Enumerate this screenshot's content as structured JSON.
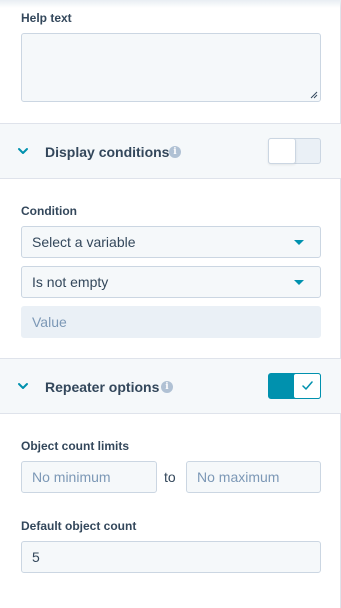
{
  "help_text": {
    "label": "Help text",
    "value": ""
  },
  "display_conditions": {
    "title": "Display conditions",
    "toggle_on": false,
    "condition_label": "Condition",
    "variable_select": "Select a variable",
    "operator_select": "Is not empty",
    "value_placeholder": "Value"
  },
  "repeater_options": {
    "title": "Repeater options",
    "toggle_on": true,
    "count_limits_label": "Object count limits",
    "min_placeholder": "No minimum",
    "to_text": "to",
    "max_placeholder": "No maximum",
    "default_count_label": "Default object count",
    "default_count_value": "5"
  },
  "colors": {
    "accent": "#0091ae",
    "text": "#33475b",
    "placeholder": "#7c98b6",
    "field_bg": "#f5f8fa",
    "border": "#cbd6e2"
  },
  "icons": {
    "section_chevron": "chevron-down-icon",
    "info": "info-icon",
    "select_caret": "caret-down-icon",
    "toggle_check": "check-icon"
  }
}
